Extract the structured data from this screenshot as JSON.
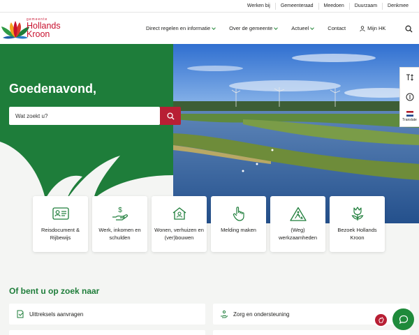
{
  "topbar": {
    "links": [
      "Werken bij",
      "Gemeenteraad",
      "Meedoen",
      "Duurzaam",
      "Denkmee"
    ]
  },
  "logo": {
    "small": "gemeente",
    "line1": "Hollands",
    "line2": "Kroon"
  },
  "nav": {
    "items": [
      {
        "label": "Direct regelen en informatie",
        "has_dropdown": true
      },
      {
        "label": "Over de gemeente",
        "has_dropdown": true
      },
      {
        "label": "Actueel",
        "has_dropdown": true
      },
      {
        "label": "Contact",
        "has_dropdown": false
      },
      {
        "label": "Mijn HK",
        "has_dropdown": false
      }
    ],
    "search_icon": "search-icon"
  },
  "hero": {
    "greeting": "Goedenavond,",
    "search_placeholder": "Wat zoekt u?"
  },
  "sidewidget": {
    "translate_label": "Translate"
  },
  "cards": [
    {
      "icon": "id-card-icon",
      "label": "Reisdocument & Rijbewijs"
    },
    {
      "icon": "hand-dollar-icon",
      "label": "Werk, inkomen en schulden"
    },
    {
      "icon": "house-icon",
      "label": "Wonen, verhuizen en (ver)bouwen"
    },
    {
      "icon": "pointing-hand-icon",
      "label": "Melding maken"
    },
    {
      "icon": "road-works-icon",
      "label": "(Weg) werkzaamheden"
    },
    {
      "icon": "tulip-icon",
      "label": "Bezoek Hollands Kroon"
    }
  ],
  "section": {
    "title": "Of bent u op zoek naar"
  },
  "links": [
    {
      "icon": "document-icon",
      "label": "Uittreksels aanvragen"
    },
    {
      "icon": "care-hand-icon",
      "label": "Zorg en ondersteuning"
    }
  ],
  "colors": {
    "green": "#1e7d3a",
    "red": "#b81f34",
    "chat": "#1e8a3a"
  }
}
